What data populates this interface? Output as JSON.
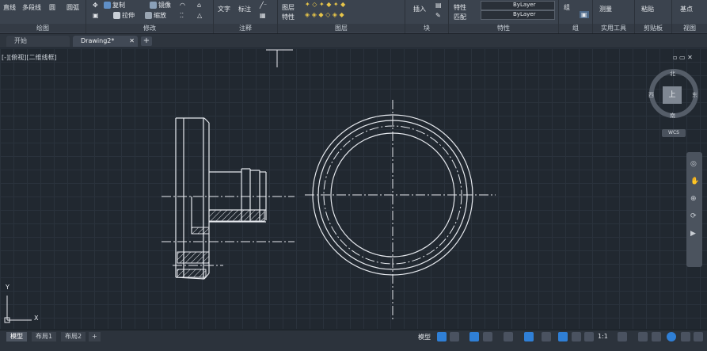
{
  "ribbon": {
    "draw": {
      "title": "绘图",
      "line": "直线",
      "polyline": "多段线",
      "circle": "圆",
      "arc": "圆弧"
    },
    "modify": {
      "title": "修改",
      "copy": "复制",
      "stretch": "拉伸",
      "mirror": "镜像",
      "scale": "缩放"
    },
    "annotate": {
      "title": "注释",
      "text": "文字",
      "dimension": "标注"
    },
    "layers": {
      "title": "图层",
      "layer_props": "图层\n特性"
    },
    "block": {
      "title": "块",
      "insert": "插入"
    },
    "properties": {
      "title": "特性",
      "match": "特性\n匹配",
      "bylayer1": "ByLayer",
      "bylayer2": "ByLayer"
    },
    "groups": {
      "title": "组",
      "group": "组"
    },
    "utilities": {
      "title": "实用工具",
      "measure": "测量"
    },
    "clipboard": {
      "title": "剪贴板",
      "paste": "粘贴"
    },
    "view": {
      "title": "视图",
      "base": "基点"
    }
  },
  "tabs": [
    {
      "label": "开始"
    },
    {
      "label": "Drawing2*"
    }
  ],
  "canvas": {
    "view_label": "[-][俯视][二维线框]",
    "window_controls": "▫ ▭ ✕"
  },
  "viewcube": {
    "north": "北",
    "south": "南",
    "east": "东",
    "west": "西",
    "face": "上",
    "wcs": "WCS"
  },
  "ucs": {
    "y": "Y",
    "x": "X"
  },
  "layout_tabs": [
    {
      "label": "模型"
    },
    {
      "label": "布局1"
    },
    {
      "label": "布局2"
    }
  ],
  "status": {
    "model": "模型",
    "scale": "1:1"
  },
  "colors": {
    "background": "#212830",
    "ribbon": "#3b434e",
    "drawing": "#e6e9ee",
    "accent": "#2f7fd6"
  }
}
